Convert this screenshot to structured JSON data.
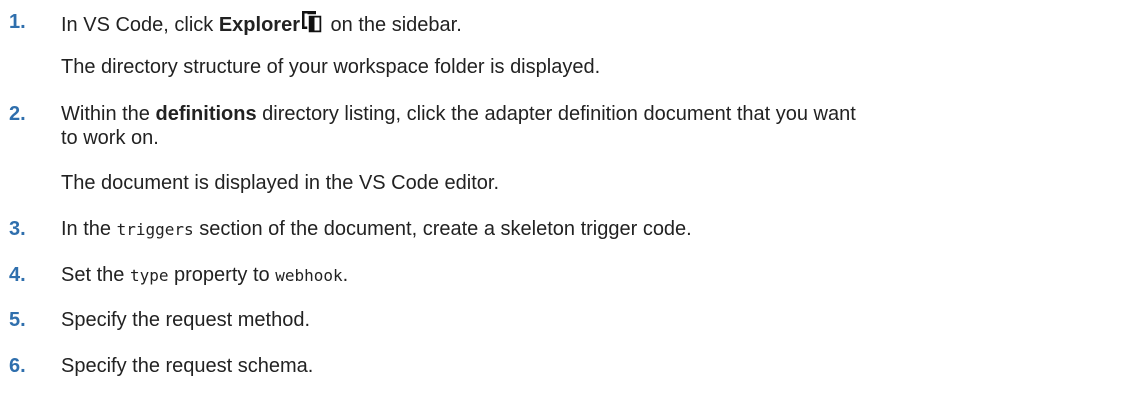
{
  "steps": [
    {
      "number": "1.",
      "text_before": "In VS Code, click ",
      "bold": "Explorer",
      "icon": "explorer-icon",
      "text_after": " on the sidebar.",
      "result": "The directory structure of your workspace folder is displayed."
    },
    {
      "number": "2.",
      "text_before": "Within the ",
      "bold": "definitions",
      "text_after": " directory listing, click the adapter definition document that you want",
      "text_line2": "to work on.",
      "result": "The document is displayed in the VS Code editor."
    },
    {
      "number": "3.",
      "text_before": "In the ",
      "code": "triggers",
      "text_after": " section of the document, create a skeleton trigger code."
    },
    {
      "number": "4.",
      "text_before": "Set the ",
      "code": "type",
      "text_middle": " property to ",
      "code2": "webhook",
      "text_after": "."
    },
    {
      "number": "5.",
      "text": "Specify the request method."
    },
    {
      "number": "6.",
      "text": "Specify the request schema."
    }
  ],
  "colors": {
    "step_number": "#2f6fad",
    "text": "#222222"
  }
}
